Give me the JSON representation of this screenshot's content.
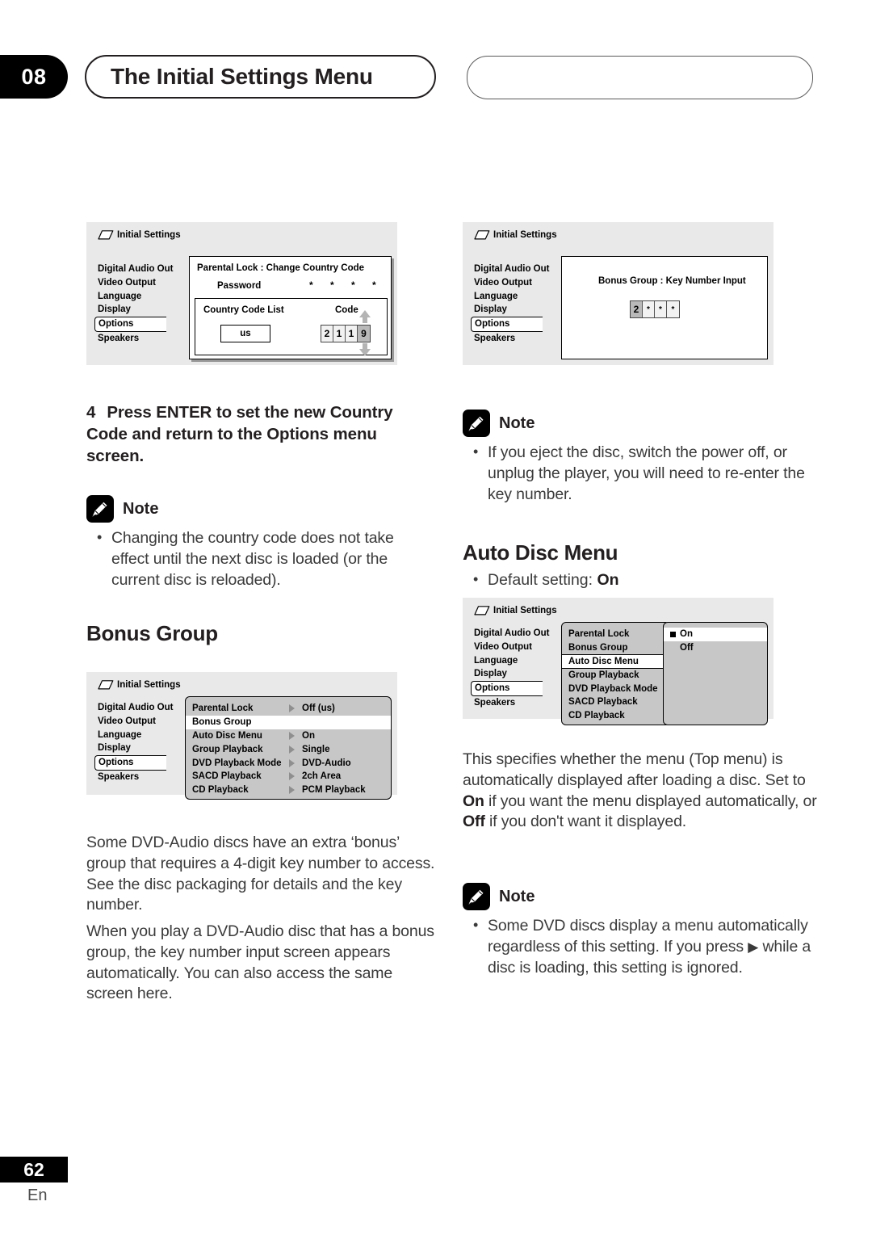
{
  "header": {
    "chapter_number": "08",
    "chapter_title": "The Initial Settings Menu",
    "right_pill_text": ""
  },
  "footer": {
    "page_number": "62",
    "language_code": "En"
  },
  "osd_common": {
    "title": "Initial Settings",
    "icon": "disc-icon",
    "sidebar": [
      "Digital Audio Out",
      "Video Output",
      "Language",
      "Display",
      "Options",
      "Speakers"
    ],
    "selected_sidebar_item": "Options"
  },
  "osd_country_code": {
    "panel_title": "Parental Lock : Change Country Code",
    "password_label": "Password",
    "password_stars": "* * * *",
    "country_code_list_label": "Country Code List",
    "country_code_value": "us",
    "code_label": "Code",
    "code_digits": [
      "2",
      "1",
      "1",
      "9"
    ],
    "code_selected_index": 3
  },
  "osd_bonus_group": {
    "panel_title": "Bonus Group : Key Number Input",
    "key_digits": [
      "2",
      "*",
      "*",
      "*"
    ],
    "key_selected_index": 0
  },
  "osd_options_menu": {
    "rows": [
      {
        "label": "Parental  Lock",
        "arrow": true,
        "value": "Off (us)",
        "highlighted": false
      },
      {
        "label": "Bonus Group",
        "arrow": false,
        "value": "",
        "highlighted": true
      },
      {
        "label": "Auto Disc Menu",
        "arrow": true,
        "value": "On",
        "highlighted": false
      },
      {
        "label": "Group Playback",
        "arrow": true,
        "value": "Single",
        "highlighted": false
      },
      {
        "label": "DVD Playback Mode",
        "arrow": true,
        "value": "DVD-Audio",
        "highlighted": false
      },
      {
        "label": "SACD Playback",
        "arrow": true,
        "value": "2ch Area",
        "highlighted": false
      },
      {
        "label": "CD Playback",
        "arrow": true,
        "value": "PCM Playback",
        "highlighted": false
      }
    ]
  },
  "osd_auto_disc_menu": {
    "rows": [
      {
        "label": "Parental  Lock",
        "highlighted": false
      },
      {
        "label": "Bonus Group",
        "highlighted": false
      },
      {
        "label": "Auto Disc Menu",
        "highlighted": true
      },
      {
        "label": "Group Playback",
        "highlighted": false
      },
      {
        "label": "DVD Playback Mode",
        "highlighted": false
      },
      {
        "label": "SACD Playback",
        "highlighted": false
      },
      {
        "label": "CD Playback",
        "highlighted": false
      }
    ],
    "submenu": [
      {
        "label": "On",
        "marked": true,
        "highlighted": true
      },
      {
        "label": "Off",
        "marked": false,
        "highlighted": false
      }
    ]
  },
  "left_column": {
    "step4_number": "4",
    "step4_text": "Press ENTER to set the new Country Code and return to the Options menu screen.",
    "note1_title": "Note",
    "note1_items": [
      "Changing the country code does not take effect until the next disc is loaded (or the current disc is reloaded)."
    ],
    "bonus_group_heading": "Bonus Group",
    "paragraph1": "Some DVD-Audio discs have an extra ‘bonus’ group that requires a 4-digit key number to access. See the disc packaging for details and the key number.",
    "paragraph2": "When you play a DVD-Audio disc that has a bonus group, the key number input screen appears automatically. You can also access the same screen here."
  },
  "right_column": {
    "note1_title": "Note",
    "note1_items": [
      "If you eject the disc, switch the power off, or unplug the player, you will need to re-enter the key number."
    ],
    "auto_disc_menu_heading": "Auto Disc Menu",
    "default_setting_prefix": "Default setting: ",
    "default_setting_value": "On",
    "paragraph1_part1": "This specifies whether the menu (Top menu) is automatically displayed after loading a disc. Set to ",
    "paragraph1_on": "On",
    "paragraph1_part2": " if you want the menu displayed automatically, or ",
    "paragraph1_off": "Off",
    "paragraph1_part3": " if you don't want it displayed.",
    "note2_title": "Note",
    "note2_text_part1": "Some DVD discs display a menu automatically regardless of this setting. If you press ",
    "note2_glyph": "▶",
    "note2_text_part2": " while a disc is loading, this setting is ignored."
  }
}
